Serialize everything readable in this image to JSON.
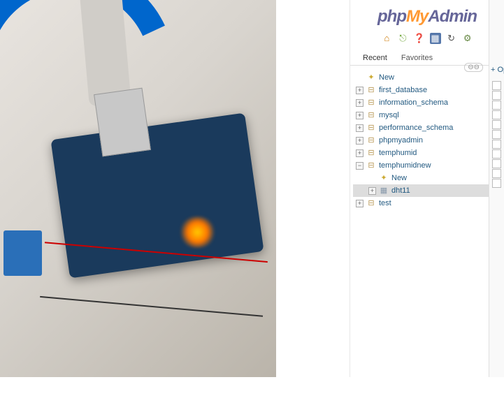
{
  "logo": {
    "part1": "php",
    "part2": "My",
    "part3": "Admin"
  },
  "tabs": {
    "recent": "Recent",
    "favorites": "Favorites"
  },
  "collapse_label": "⊖⊖",
  "op_link": "+ Op",
  "tree": {
    "new": "New",
    "db_first": "first_database",
    "db_info": "information_schema",
    "db_mysql": "mysql",
    "db_perf": "performance_schema",
    "db_pma": "phpmyadmin",
    "db_th": "temphumid",
    "db_thn": "temphumidnew",
    "thn_new": "New",
    "thn_dht": "dht11",
    "db_test": "test"
  }
}
